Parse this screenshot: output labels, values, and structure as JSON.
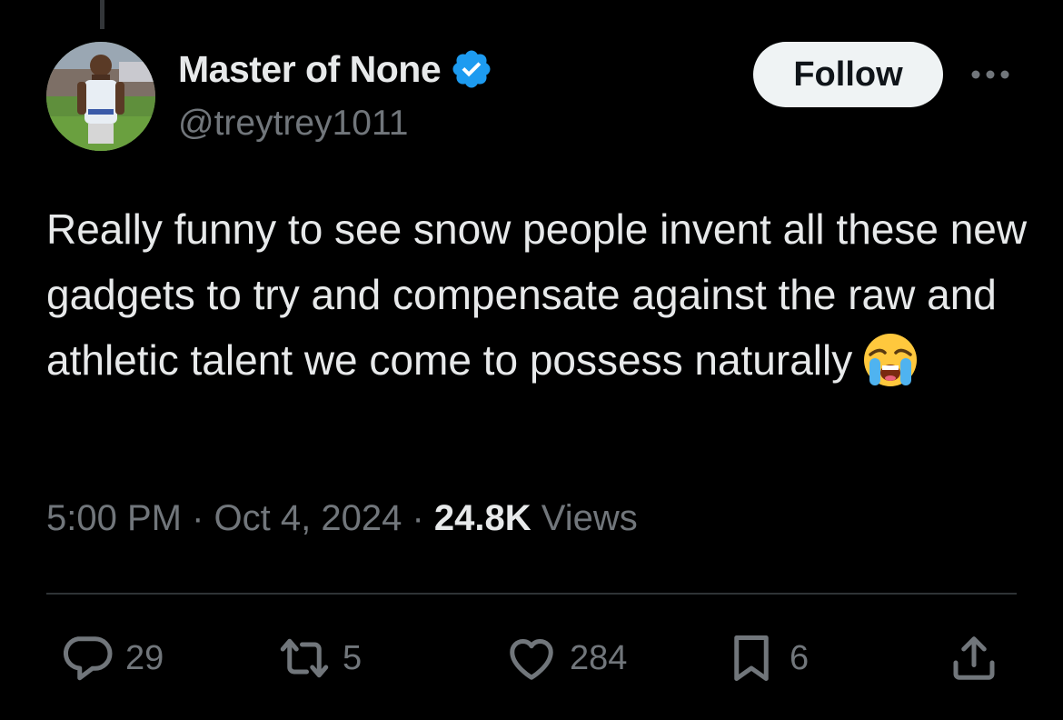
{
  "user": {
    "display_name": "Master of None",
    "handle": "@treytrey1011",
    "verified": true,
    "verified_color": "#1d9bf0"
  },
  "follow_label": "Follow",
  "tweet": {
    "text": "Really funny to see snow people invent all these new gadgets to try and compensate against the raw and athletic talent we come to possess naturally",
    "emoji": "loudly-crying-face-icon"
  },
  "meta": {
    "time": "5:00 PM",
    "separator": "·",
    "date": "Oct 4, 2024",
    "views_count": "24.8K",
    "views_label": "Views"
  },
  "actions": {
    "replies": "29",
    "reposts": "5",
    "likes": "284",
    "bookmarks": "6"
  },
  "colors": {
    "background": "#000000",
    "text": "#e7e9ea",
    "secondary": "#71767b",
    "divider": "#2f3336"
  }
}
